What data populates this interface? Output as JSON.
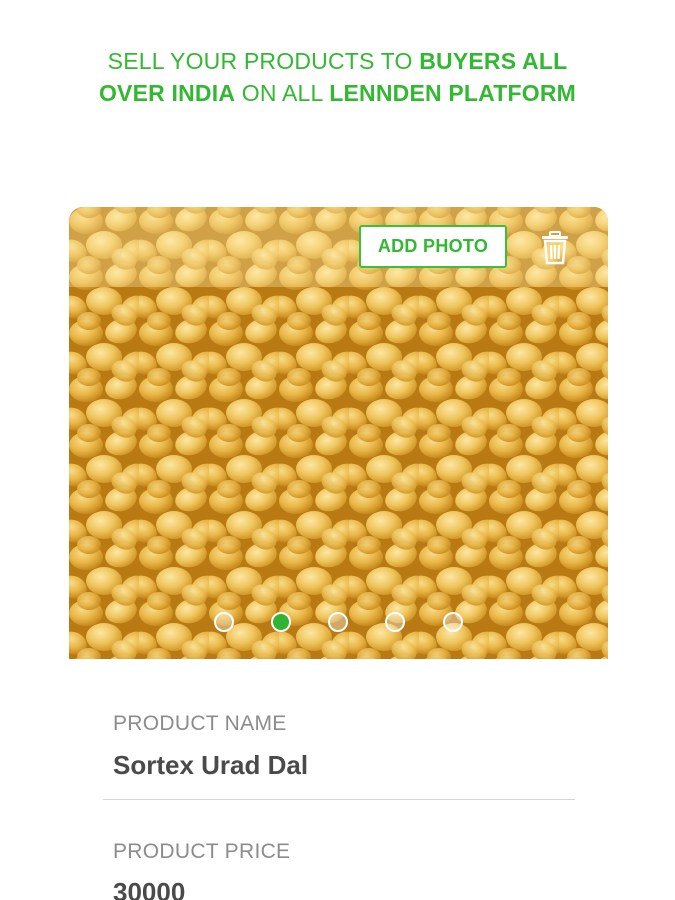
{
  "headline": {
    "part1": "SELL YOUR PRODUCTS TO ",
    "part2": "BUYERS ALL",
    "part3": "OVER INDIA",
    "part4": " ON ALL ",
    "part5": "LENNDEN PLATFORM"
  },
  "photo": {
    "add_photo_label": "ADD PHOTO",
    "carousel_count": 5,
    "active_index": 1
  },
  "form": {
    "product_name_label": "PRODUCT NAME",
    "product_name_value": "Sortex Urad Dal",
    "product_price_label": "PRODUCT PRICE",
    "product_price_value": "30000"
  },
  "colors": {
    "accent": "#33b832",
    "label": "#8c8c8c",
    "value": "#4a4a4a"
  },
  "icons": [
    "trash-icon"
  ]
}
